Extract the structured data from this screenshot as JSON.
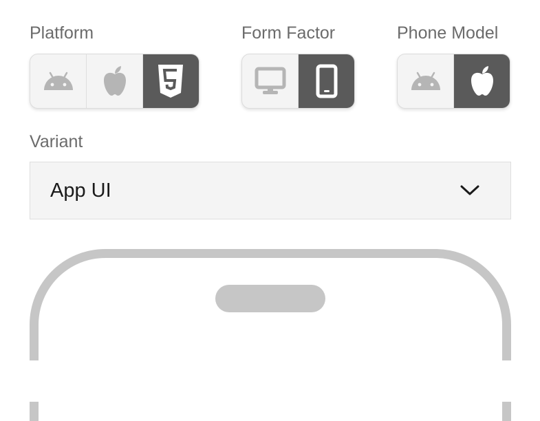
{
  "platform": {
    "label": "Platform",
    "options": [
      {
        "icon": "android-icon",
        "selected": false
      },
      {
        "icon": "apple-icon",
        "selected": false
      },
      {
        "icon": "html5-icon",
        "selected": true
      }
    ]
  },
  "form_factor": {
    "label": "Form Factor",
    "options": [
      {
        "icon": "desktop-icon",
        "selected": false
      },
      {
        "icon": "phone-icon",
        "selected": true
      }
    ]
  },
  "phone_model": {
    "label": "Phone Model",
    "options": [
      {
        "icon": "android-icon",
        "selected": false
      },
      {
        "icon": "apple-icon",
        "selected": true
      }
    ]
  },
  "variant": {
    "label": "Variant",
    "selected": "App UI"
  },
  "colors": {
    "selected_bg": "#5a5a5a",
    "unselected_bg": "#f4f4f4",
    "icon_inactive": "#b5b5b5",
    "icon_active": "#ffffff",
    "phone_frame": "#c6c6c6"
  }
}
